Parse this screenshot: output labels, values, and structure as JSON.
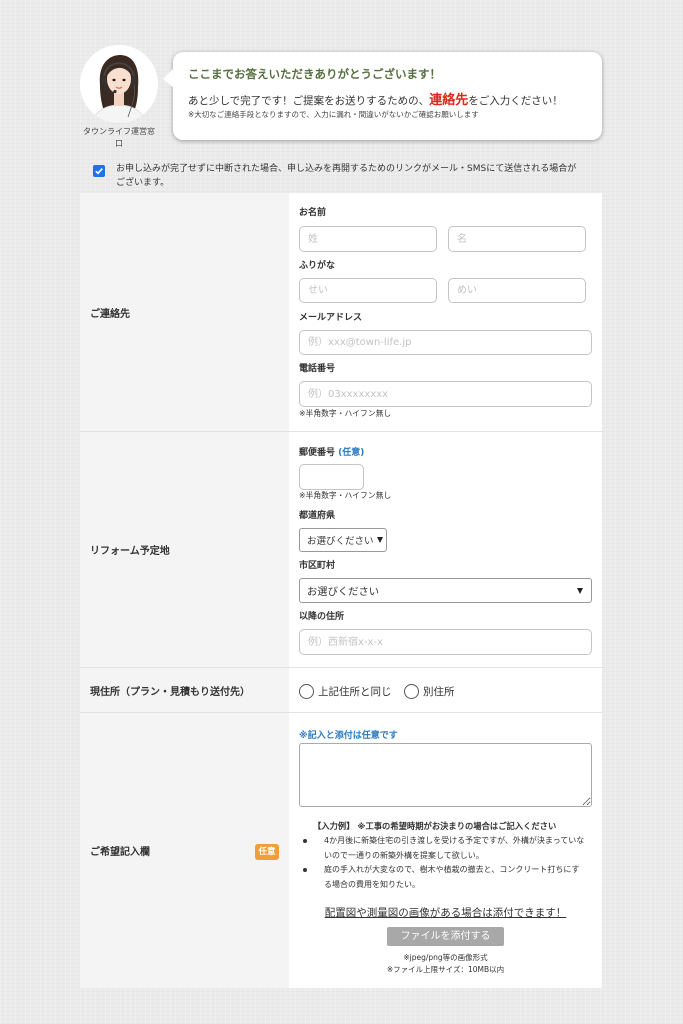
{
  "operator": {
    "name": "タウンライフ運営窓口"
  },
  "bubble": {
    "title": "ここまでお答えいただきありがとうございます！",
    "lead_before": "あと少しで完了です！ご提案をお送りするための、",
    "lead_highlight": "連絡先",
    "lead_after": "をご入力ください！",
    "note": "※大切なご連絡手段となりますので、入力に漏れ・間違いがないかご確認お願いします"
  },
  "resume_notice": {
    "checked": true,
    "text": "お申し込みが完了せずに中断された場合、申し込みを再開するためのリンクがメール・SMSにて送信される場合がございます。"
  },
  "contact": {
    "label": "ご連絡先",
    "name_label": "お名前",
    "last_name_placeholder": "姓",
    "first_name_placeholder": "名",
    "kana_label": "ふりがな",
    "last_kana_placeholder": "せい",
    "first_kana_placeholder": "めい",
    "email_label": "メールアドレス",
    "email_placeholder": "例）xxx@town-life.jp",
    "phone_label": "電話番号",
    "phone_placeholder": "例）03xxxxxxxx",
    "phone_note": "※半角数字・ハイフン無し"
  },
  "site": {
    "label": "リフォーム予定地",
    "postal_label": "郵便番号",
    "postal_optional": "(任意)",
    "postal_note": "※半角数字・ハイフン無し",
    "prefecture_label": "都道府県",
    "prefecture_selected": "お選びください",
    "city_label": "市区町村",
    "city_selected": "お選びください",
    "address_label": "以降の住所",
    "address_placeholder": "例）西新宿x-x-x"
  },
  "current_address": {
    "label": "現住所（プラン・見積もり送付先）",
    "options": [
      {
        "label": "上記住所と同じ",
        "selected": false
      },
      {
        "label": "別住所",
        "selected": false
      }
    ]
  },
  "request": {
    "label": "ご希望記入欄",
    "badge": "任意",
    "optional_note": "※記入と添付は任意です",
    "example_heading": "【入力例】 ※工事の希望時期がお決まりの場合はご記入ください",
    "examples": [
      "4か月後に新築住宅の引き渡しを受ける予定ですが、外構が決まっていないので一通りの新築外構を提案して欲しい。",
      "庭の手入れが大変なので、樹木や植栽の撤去と、コンクリート打ちにする場合の費用を知りたい。"
    ],
    "attach_prompt": "配置図や測量図の画像がある場合は添付できます！",
    "attach_button": "ファイルを添付する",
    "format_note": "※jpeg/png等の画像形式",
    "size_note": "※ファイル上限サイズ：10MB以内"
  },
  "icons": {
    "avatar": "operator-headset-avatar",
    "checkbox": "check-icon",
    "select_arrow": "caret-down-icon",
    "radio": "radio-icon"
  },
  "colors": {
    "title_green": "#567040",
    "highlight_red": "#e0251b",
    "link_blue": "#2a7ac0",
    "badge_orange": "#f19d38",
    "checkbox_blue": "#1a73e8",
    "button_gray": "#a8a8a8"
  }
}
